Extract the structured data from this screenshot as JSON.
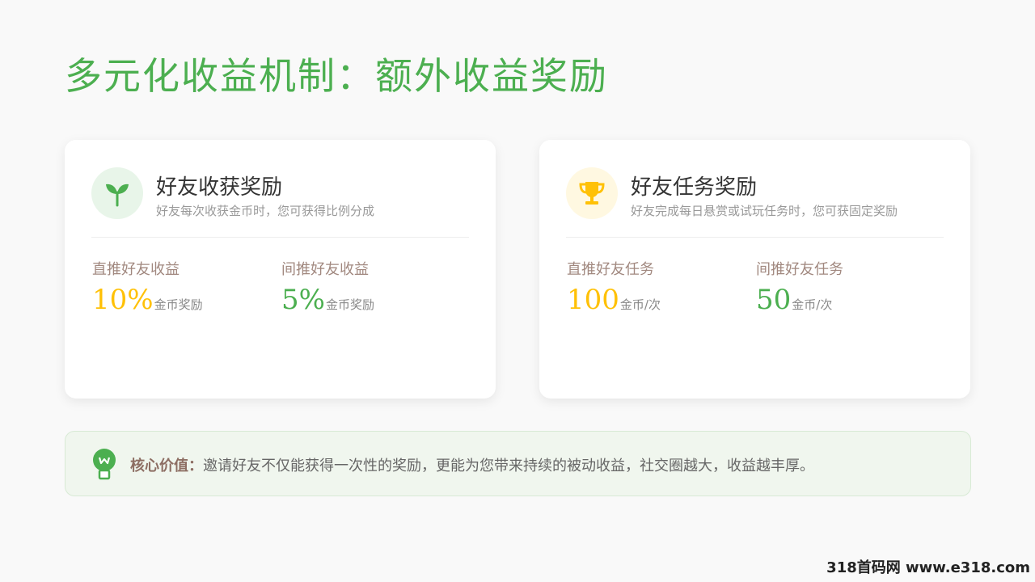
{
  "page": {
    "title": "多元化收益机制：额外收益奖励",
    "watermark": "318首码网 www.e318.com"
  },
  "cards": [
    {
      "icon": "sprout-icon",
      "title": "好友收获奖励",
      "subtitle": "好友每次收获金币时，您可获得比例分成",
      "stats": [
        {
          "label": "直推好友收益",
          "value": "10%",
          "unit": "金币奖励",
          "color": "#ffc107"
        },
        {
          "label": "间推好友收益",
          "value": "5%",
          "unit": "金币奖励",
          "color": "#4caf50"
        }
      ]
    },
    {
      "icon": "trophy-icon",
      "title": "好友任务奖励",
      "subtitle": "好友完成每日悬赏或试玩任务时，您可获固定奖励",
      "stats": [
        {
          "label": "直推好友任务",
          "value": "100",
          "unit": "金币/次",
          "color": "#ffc107"
        },
        {
          "label": "间推好友任务",
          "value": "50",
          "unit": "金币/次",
          "color": "#4caf50"
        }
      ]
    }
  ],
  "footer": {
    "icon": "lightbulb-icon",
    "label": "核心价值：",
    "text": "邀请好友不仅能获得一次性的奖励，更能为您带来持续的被动收益，社交圈越大，收益越丰厚。"
  },
  "colors": {
    "accent_green": "#4caf50",
    "accent_yellow": "#ffc107",
    "label_brown": "#a1887f"
  }
}
